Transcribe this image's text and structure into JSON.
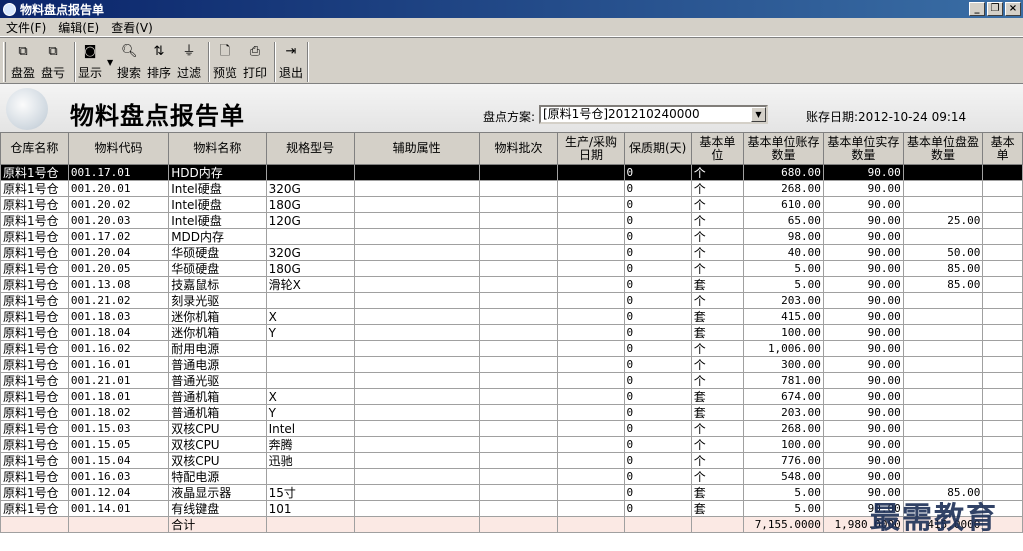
{
  "window": {
    "title": "物料盘点报告单",
    "buttons": [
      "_",
      "❐",
      "×"
    ]
  },
  "menu": [
    "文件(F)",
    "编辑(E)",
    "查看(V)"
  ],
  "toolbar": {
    "panying": "盘盈",
    "pankui": "盘亏",
    "xianshi": "显示",
    "sousuo": "搜索",
    "paixu": "排序",
    "guolv": "过滤",
    "yulan": "预览",
    "dayin": "打印",
    "tuichu": "退出"
  },
  "header": {
    "title": "物料盘点报告单",
    "plan_label": "盘点方案:",
    "plan_value": "[原料1号仓]201210240000",
    "date_label": "账存日期:2012-10-24 09:14"
  },
  "table": {
    "columns": [
      "仓库名称",
      "物料代码",
      "物料名称",
      "规格型号",
      "辅助属性",
      "物料批次",
      "生产/采购日期",
      "保质期(天)",
      "基本单位",
      "基本单位账存数量",
      "基本单位实存数量",
      "基本单位盘盈数量",
      "基本单"
    ],
    "rows": [
      [
        "原料1号仓",
        "001.17.01",
        "HDD内存",
        "",
        "",
        "",
        "",
        "0",
        "个",
        "680.00",
        "90.00",
        ""
      ],
      [
        "原料1号仓",
        "001.20.01",
        "Intel硬盘",
        "320G",
        "",
        "",
        "",
        "0",
        "个",
        "268.00",
        "90.00",
        ""
      ],
      [
        "原料1号仓",
        "001.20.02",
        "Intel硬盘",
        "180G",
        "",
        "",
        "",
        "0",
        "个",
        "610.00",
        "90.00",
        ""
      ],
      [
        "原料1号仓",
        "001.20.03",
        "Intel硬盘",
        "120G",
        "",
        "",
        "",
        "0",
        "个",
        "65.00",
        "90.00",
        "25.00"
      ],
      [
        "原料1号仓",
        "001.17.02",
        "MDD内存",
        "",
        "",
        "",
        "",
        "0",
        "个",
        "98.00",
        "90.00",
        ""
      ],
      [
        "原料1号仓",
        "001.20.04",
        "华硕硬盘",
        "320G",
        "",
        "",
        "",
        "0",
        "个",
        "40.00",
        "90.00",
        "50.00"
      ],
      [
        "原料1号仓",
        "001.20.05",
        "华硕硬盘",
        "180G",
        "",
        "",
        "",
        "0",
        "个",
        "5.00",
        "90.00",
        "85.00"
      ],
      [
        "原料1号仓",
        "001.13.08",
        "技嘉鼠标",
        "滑轮X",
        "",
        "",
        "",
        "0",
        "套",
        "5.00",
        "90.00",
        "85.00"
      ],
      [
        "原料1号仓",
        "001.21.02",
        "刻录光驱",
        "",
        "",
        "",
        "",
        "0",
        "个",
        "203.00",
        "90.00",
        ""
      ],
      [
        "原料1号仓",
        "001.18.03",
        "迷你机箱",
        "X",
        "",
        "",
        "",
        "0",
        "套",
        "415.00",
        "90.00",
        ""
      ],
      [
        "原料1号仓",
        "001.18.04",
        "迷你机箱",
        "Y",
        "",
        "",
        "",
        "0",
        "套",
        "100.00",
        "90.00",
        ""
      ],
      [
        "原料1号仓",
        "001.16.02",
        "耐用电源",
        "",
        "",
        "",
        "",
        "0",
        "个",
        "1,006.00",
        "90.00",
        ""
      ],
      [
        "原料1号仓",
        "001.16.01",
        "普通电源",
        "",
        "",
        "",
        "",
        "0",
        "个",
        "300.00",
        "90.00",
        ""
      ],
      [
        "原料1号仓",
        "001.21.01",
        "普通光驱",
        "",
        "",
        "",
        "",
        "0",
        "个",
        "781.00",
        "90.00",
        ""
      ],
      [
        "原料1号仓",
        "001.18.01",
        "普通机箱",
        "X",
        "",
        "",
        "",
        "0",
        "套",
        "674.00",
        "90.00",
        ""
      ],
      [
        "原料1号仓",
        "001.18.02",
        "普通机箱",
        "Y",
        "",
        "",
        "",
        "0",
        "套",
        "203.00",
        "90.00",
        ""
      ],
      [
        "原料1号仓",
        "001.15.03",
        "双核CPU",
        "Intel",
        "",
        "",
        "",
        "0",
        "个",
        "268.00",
        "90.00",
        ""
      ],
      [
        "原料1号仓",
        "001.15.05",
        "双核CPU",
        "奔腾",
        "",
        "",
        "",
        "0",
        "个",
        "100.00",
        "90.00",
        ""
      ],
      [
        "原料1号仓",
        "001.15.04",
        "双核CPU",
        "迅驰",
        "",
        "",
        "",
        "0",
        "个",
        "776.00",
        "90.00",
        ""
      ],
      [
        "原料1号仓",
        "001.16.03",
        "特配电源",
        "",
        "",
        "",
        "",
        "0",
        "个",
        "548.00",
        "90.00",
        ""
      ],
      [
        "原料1号仓",
        "001.12.04",
        "液晶显示器",
        "15寸",
        "",
        "",
        "",
        "0",
        "套",
        "5.00",
        "90.00",
        "85.00"
      ],
      [
        "原料1号仓",
        "001.14.01",
        "有线键盘",
        "101",
        "",
        "",
        "",
        "0",
        "套",
        "5.00",
        "90.00",
        ""
      ]
    ],
    "total": [
      "",
      "",
      "合计",
      "",
      "",
      "",
      "",
      "",
      "",
      "7,155.0000",
      "1,980.0000",
      "415.0000"
    ]
  },
  "watermark": "最需教育"
}
